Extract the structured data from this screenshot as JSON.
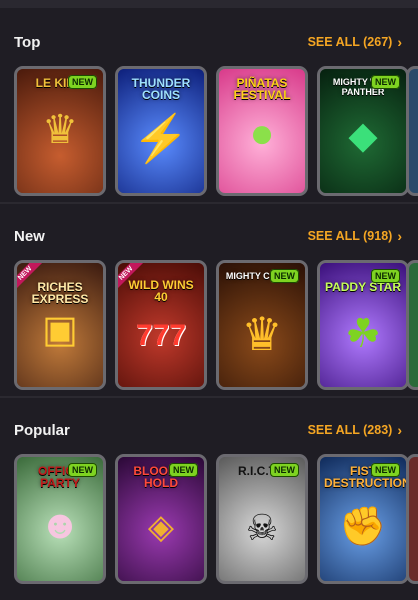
{
  "sections": [
    {
      "title": "Top",
      "see_all": "SEE ALL (267)",
      "tiles": [
        {
          "name": "LE KING",
          "badge": "NEW",
          "bg": "#7a3a1f",
          "accent": "#f0c13a",
          "symbol": "👑"
        },
        {
          "name": "THUNDER COINS",
          "badge": "",
          "bg": "#1d3cc6",
          "accent": "#ffd21a",
          "symbol": "⚡"
        },
        {
          "name": "PIÑATAS FESTIVAL",
          "badge": "",
          "bg": "#ff7fbf",
          "accent": "#8be04a",
          "symbol": "★"
        },
        {
          "name": "MIGHTY WILD PANTHER",
          "badge": "NEW",
          "bg": "#0f3a1c",
          "accent": "#3be07a",
          "symbol": "◆"
        }
      ]
    },
    {
      "title": "New",
      "see_all": "SEE ALL (918)",
      "tiles": [
        {
          "name": "RICHES EXPRESS",
          "badge": "",
          "corner": "NEW",
          "bg": "#6e3a2a",
          "accent": "#ffcc33",
          "symbol": "🚂"
        },
        {
          "name": "WILD WINS 40",
          "badge": "",
          "corner": "NEW",
          "bg": "#8b1d12",
          "accent": "#ff3b2f",
          "symbol": "777"
        },
        {
          "name": "MIGHTY CROWN",
          "badge": "NEW",
          "bg": "#5a2a10",
          "accent": "#ffbf2a",
          "symbol": "♛"
        },
        {
          "name": "PADDY STAR",
          "badge": "NEW",
          "bg": "#6a2fbf",
          "accent": "#7ed321",
          "symbol": "☘"
        }
      ]
    },
    {
      "title": "Popular",
      "see_all": "SEE ALL (283)",
      "tiles": [
        {
          "name": "OFFICE PARTY",
          "badge": "NEW",
          "bg": "#7ab57a",
          "accent": "#f7c6e0",
          "symbol": "♠"
        },
        {
          "name": "BLOOD & HOLD",
          "badge": "NEW",
          "bg": "#5b1a6e",
          "accent": "#f0b030",
          "symbol": "⚗"
        },
        {
          "name": "R.I.C.T.V",
          "badge": "NEW",
          "bg": "#9a9a9a",
          "accent": "#111111",
          "symbol": "✚"
        },
        {
          "name": "FIST DESTRUCTION",
          "badge": "NEW",
          "bg": "#2a6ab7",
          "accent": "#ff8a2a",
          "symbol": "✊"
        }
      ]
    }
  ],
  "icons": {
    "chevron": "›"
  }
}
